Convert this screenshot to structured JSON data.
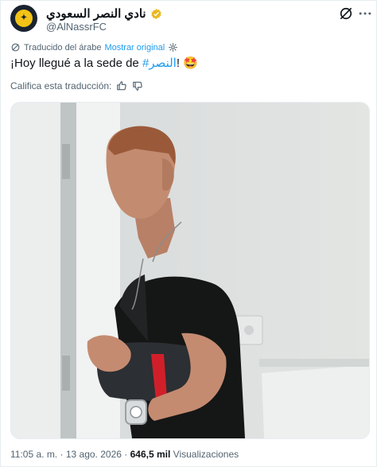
{
  "account": {
    "display_name": "نادي النصر السعودي",
    "handle": "@AlNassrFC",
    "verified": true,
    "avatar_colors": {
      "background": "#1a2330",
      "emblem": "#f3c316"
    }
  },
  "translation": {
    "note": "Traducido del árabe",
    "show_original": "Mostrar original",
    "rate_label": "Califica esta traducción:"
  },
  "tweet": {
    "text_before": "¡Hoy llegué a la sede de ",
    "hashtag": "#النصر",
    "text_after": "! ",
    "emoji": "🤩"
  },
  "footer": {
    "time": "11:05 a. m.",
    "separator": "·",
    "date": "13 ago. 2026",
    "views_count": "646,5 mil",
    "views_label": "Visualizaciones"
  },
  "colors": {
    "link": "#1d9bf0",
    "secondary_text": "#536471",
    "primary_text": "#0f1419",
    "verified_badge": "#e8b923"
  }
}
